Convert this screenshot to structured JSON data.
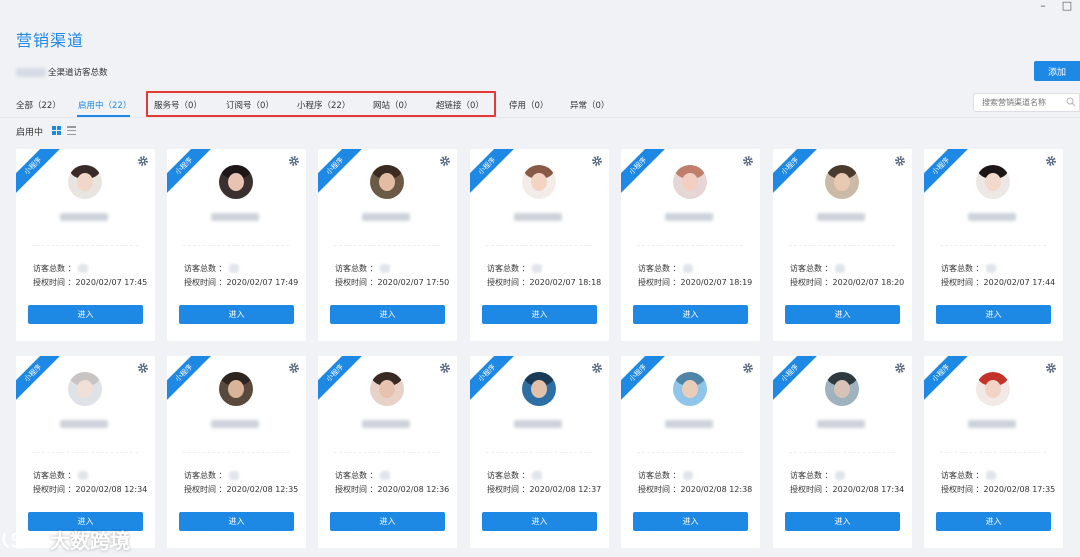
{
  "page": {
    "title": "营销渠道",
    "visitor_total_label": "全渠道访客总数",
    "add_button": "添加",
    "search_placeholder": "搜索营销渠道名称",
    "section_label": "启用中"
  },
  "tabs": [
    {
      "label": "全部（22）",
      "active": false
    },
    {
      "label": "启用中（22）",
      "active": true
    },
    {
      "label": "服务号（0）",
      "active": false
    },
    {
      "label": "订阅号（0）",
      "active": false
    },
    {
      "label": "小程序（22）",
      "active": false
    },
    {
      "label": "网站（0）",
      "active": false
    },
    {
      "label": "超链接（0）",
      "active": false
    },
    {
      "label": "停用（0）",
      "active": false
    },
    {
      "label": "异常（0）",
      "active": false
    }
  ],
  "card_labels": {
    "ribbon": "小程序",
    "visitors": "访客总数 ：",
    "auth_time_prefix": "授权时间 ：",
    "enter": "进入"
  },
  "cards": [
    {
      "auth_time": "2020/02/07 17:45"
    },
    {
      "auth_time": "2020/02/07 17:49"
    },
    {
      "auth_time": "2020/02/07 17:50"
    },
    {
      "auth_time": "2020/02/07 18:18"
    },
    {
      "auth_time": "2020/02/07 18:19"
    },
    {
      "auth_time": "2020/02/07 18:20"
    },
    {
      "auth_time": "2020/02/07 17:44"
    },
    {
      "auth_time": "2020/02/08 12:34"
    },
    {
      "auth_time": "2020/02/08 12:35"
    },
    {
      "auth_time": "2020/02/08 12:36"
    },
    {
      "auth_time": "2020/02/08 12:37"
    },
    {
      "auth_time": "2020/02/08 12:38"
    },
    {
      "auth_time": "2020/02/08 17:34"
    },
    {
      "auth_time": "2020/02/08 17:35"
    }
  ],
  "watermark": "大数跨境",
  "colors": {
    "accent": "#1e88e5",
    "highlight": "#e53935",
    "background": "#f0f2f5"
  },
  "icons": [
    "minimize-icon",
    "maximize-icon",
    "grid-view-icon",
    "list-view-icon",
    "search-icon",
    "gear-icon"
  ]
}
